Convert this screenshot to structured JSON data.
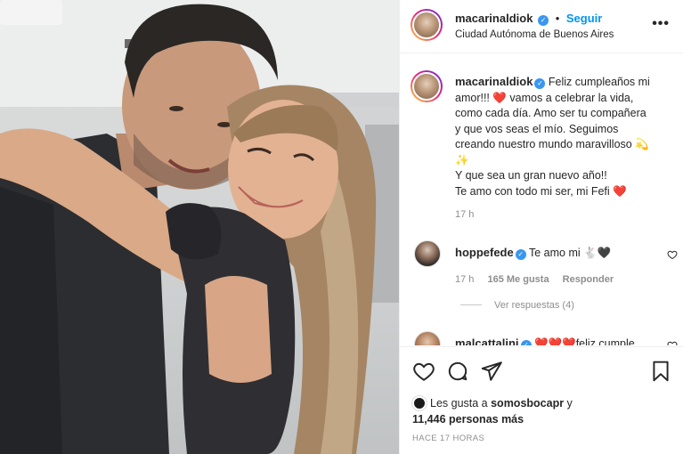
{
  "post": {
    "username": "macarinaldiok",
    "follow_label": "Seguir",
    "separator": "•",
    "location": "Ciudad Autónoma de Buenos Aires",
    "more_label": "•••",
    "verified_glyph": "✓"
  },
  "caption": {
    "username": "macarinaldiok",
    "text": " Feliz cumpleaños mi\namor!!! ❤️ vamos a celebrar la vida,\ncomo cada día. Amo ser tu compañera\ny que vos seas el mío. Seguimos\ncreando nuestro mundo maravilloso 💫\n✨\nY que sea un gran nuevo año!!\nTe amo con todo mi ser, mi Fefi ❤️",
    "time": "17 h"
  },
  "comments": [
    {
      "username": "hoppefede",
      "text": " Te amo mi 🐇🖤",
      "time": "17 h",
      "likes": "165 Me gusta",
      "reply_label": "Responder",
      "view_replies": "Ver respuestas (4)"
    },
    {
      "username": "malcattalini",
      "text": " ❤️❤️❤️feliz cumple"
    }
  ],
  "actions": {
    "likes_prefix": "Les gusta a ",
    "likes_user": "somosbocapr",
    "likes_suffix": " y",
    "likes_count": "11,446 personas más",
    "timestamp": "HACE 17 HORAS"
  },
  "colors": {
    "accent": "#0095f6",
    "verified": "#3897f0",
    "heart": "#ed4956",
    "muted": "#8e8e8e"
  }
}
